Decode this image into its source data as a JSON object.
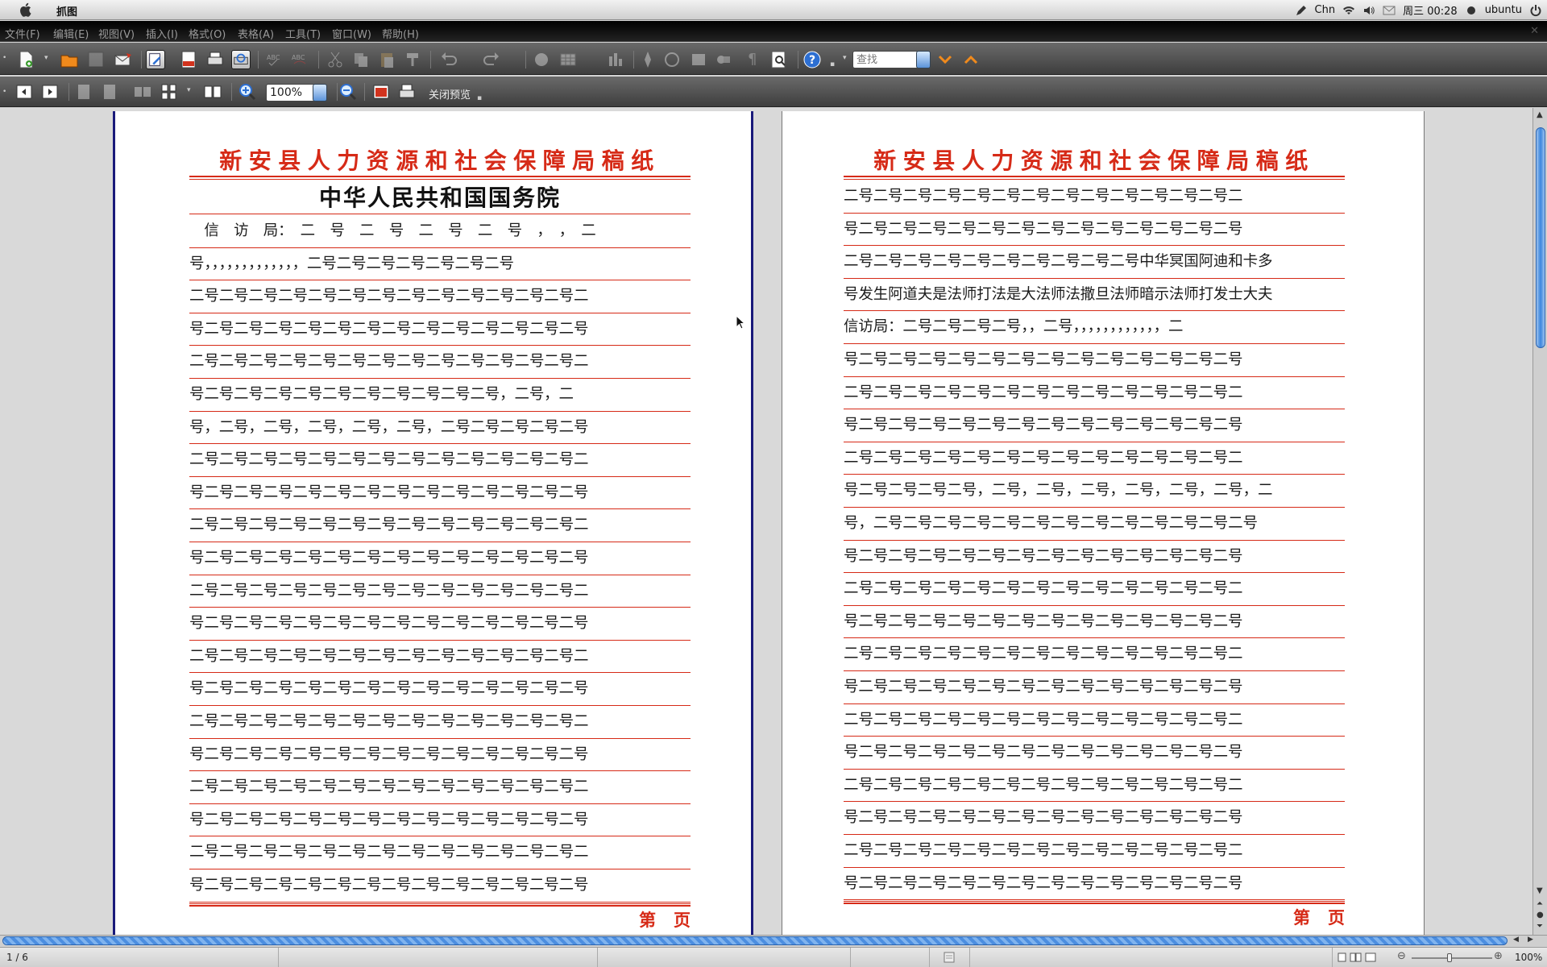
{
  "system_bar": {
    "app_name": "抓图",
    "input_method": "Chn",
    "clock": "周三 00:28",
    "user": "ubuntu"
  },
  "menu": [
    "文件(F)",
    "编辑(E)",
    "视图(V)",
    "插入(I)",
    "格式(O)",
    "表格(A)",
    "工具(T)",
    "窗口(W)",
    "帮助(H)"
  ],
  "toolbar": {
    "search_placeholder": "查找",
    "zoom_value": "100%",
    "close_preview_label": "关闭预览"
  },
  "pages": [
    {
      "header": "新安县人力资源和社会保障局稿纸",
      "title": "中华人民共和国国务院",
      "lines": [
        "　信　访　局：　二　号　二　号　二　号　二　号　，　，　二",
        "号，，，，，，，，，，，，，二号二号二号二号二号二号二号",
        "二号二号二号二号二号二号二号二号二号二号二号二号二号二",
        "号二号二号二号二号二号二号二号二号二号二号二号二号二号",
        "二号二号二号二号二号二号二号二号二号二号二号二号二号二",
        "号二号二号二号二号二号二号二号二号二号二号，二号，二",
        "号，二号，二号，二号，二号，二号，二号二号二号二号二号",
        "二号二号二号二号二号二号二号二号二号二号二号二号二号二",
        "号二号二号二号二号二号二号二号二号二号二号二号二号二号",
        "二号二号二号二号二号二号二号二号二号二号二号二号二号二",
        "号二号二号二号二号二号二号二号二号二号二号二号二号二号",
        "二号二号二号二号二号二号二号二号二号二号二号二号二号二",
        "号二号二号二号二号二号二号二号二号二号二号二号二号二号",
        "二号二号二号二号二号二号二号二号二号二号二号二号二号二",
        "号二号二号二号二号二号二号二号二号二号二号二号二号二号",
        "二号二号二号二号二号二号二号二号二号二号二号二号二号二",
        "号二号二号二号二号二号二号二号二号二号二号二号二号二号",
        "二号二号二号二号二号二号二号二号二号二号二号二号二号二",
        "号二号二号二号二号二号二号二号二号二号二号二号二号二号",
        "二号二号二号二号二号二号二号二号二号二号二号二号二号二",
        "号二号二号二号二号二号二号二号二号二号二号二号二号二号"
      ],
      "footer": "第页"
    },
    {
      "header": "新安县人力资源和社会保障局稿纸",
      "lines": [
        "二号二号二号二号二号二号二号二号二号二号二号二号二号二",
        "号二号二号二号二号二号二号二号二号二号二号二号二号二号",
        "二号二号二号二号二号二号二号二号二号二号中华冥国阿迪和卡多",
        "号发生阿道夫是法师打法是大法师法撒旦法师暗示法师打发士大夫",
        "信访局：二号二号二号二号，，二号，，，，，，，，，，，，二",
        "号二号二号二号二号二号二号二号二号二号二号二号二号二号",
        "二号二号二号二号二号二号二号二号二号二号二号二号二号二",
        "号二号二号二号二号二号二号二号二号二号二号二号二号二号",
        "二号二号二号二号二号二号二号二号二号二号二号二号二号二",
        "号二号二号二号二号，二号，二号，二号，二号，二号，二号，二",
        "号，二号二号二号二号二号二号二号二号二号二号二号二号二号",
        "号二号二号二号二号二号二号二号二号二号二号二号二号二号",
        "二号二号二号二号二号二号二号二号二号二号二号二号二号二",
        "号二号二号二号二号二号二号二号二号二号二号二号二号二号",
        "二号二号二号二号二号二号二号二号二号二号二号二号二号二",
        "号二号二号二号二号二号二号二号二号二号二号二号二号二号",
        "二号二号二号二号二号二号二号二号二号二号二号二号二号二",
        "号二号二号二号二号二号二号二号二号二号二号二号二号二号",
        "二号二号二号二号二号二号二号二号二号二号二号二号二号二",
        "号二号二号二号二号二号二号二号二号二号二号二号二号二号",
        "二号二号二号二号二号二号二号二号二号二号二号二号二号二",
        "号二号二号二号二号二号二号二号二号二号二号二号二号二号"
      ],
      "footer": "第页"
    }
  ],
  "status_bar": {
    "page_indicator": "1 / 6",
    "zoom_percent": "100%"
  },
  "colors": {
    "paper_red": "#d62a17",
    "page_border": "#1a1a7a",
    "scroll_blue": "#3b86de"
  },
  "icons": [
    "apple-icon",
    "pen-icon",
    "wifi-icon",
    "volume-icon",
    "mail-icon",
    "power-icon",
    "new-doc-icon",
    "open-icon",
    "save-icon",
    "mail-send-icon",
    "edit-icon",
    "pdf-icon",
    "print-icon",
    "print-preview-icon",
    "spellcheck-icon",
    "cut-icon",
    "copy-icon",
    "paste-icon",
    "undo-icon",
    "redo-icon",
    "help-icon",
    "chevron-down-icon",
    "chevron-up-icon",
    "zoom-in-icon",
    "zoom-out-icon"
  ]
}
